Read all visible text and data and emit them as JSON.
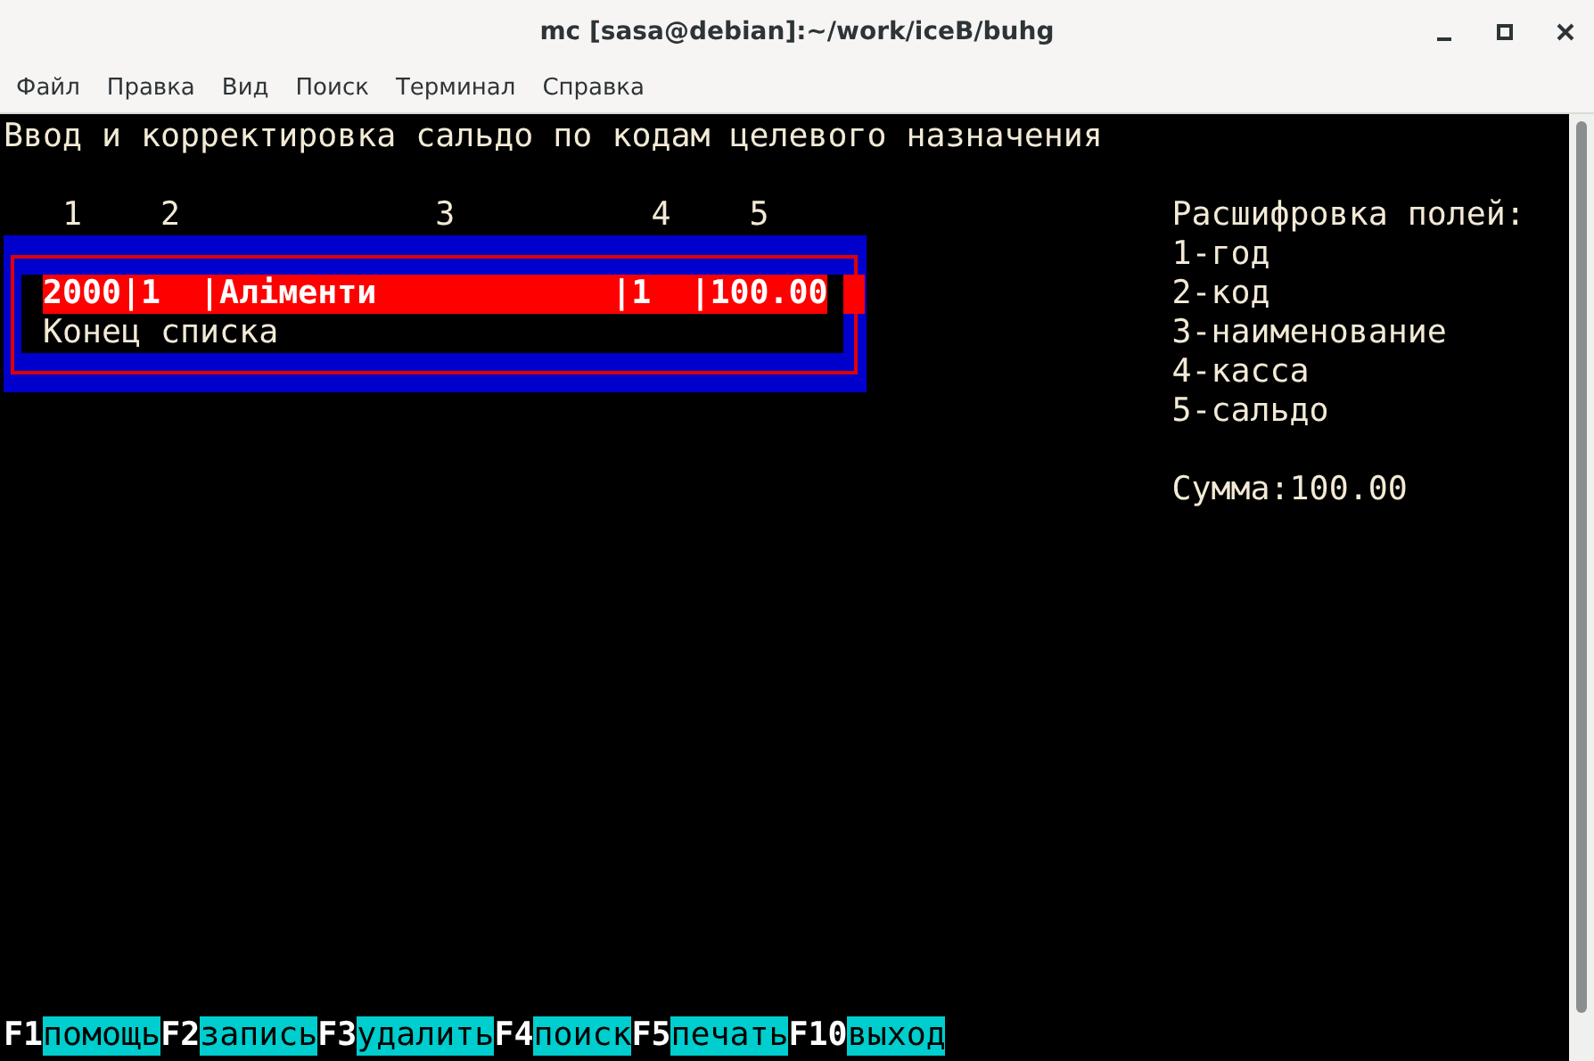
{
  "window": {
    "title": "mc [sasa@debian]:~/work/iceB/buhg"
  },
  "menu": [
    "Файл",
    "Правка",
    "Вид",
    "Поиск",
    "Терминал",
    "Справка"
  ],
  "heading": "Ввод и корректировка сальдо по кодам целевого назначения",
  "column_numbers": [
    "1",
    "2",
    "3",
    "4",
    "5"
  ],
  "rows": [
    {
      "text": "2000|1  |Аліменти            |1  |100.00",
      "selected": true
    },
    {
      "text": "Конец списка",
      "selected": false
    }
  ],
  "legend": {
    "title": "Расшифровка полей:",
    "items": [
      "1-год",
      "2-код",
      "3-наименование",
      "4-касса",
      "5-сальдо"
    ]
  },
  "total": "Сумма:100.00",
  "function_keys": [
    {
      "key": "F1",
      "label": "помощь"
    },
    {
      "key": "F2",
      "label": "запись"
    },
    {
      "key": "F3",
      "label": "удалить"
    },
    {
      "key": "F4",
      "label": "поиск"
    },
    {
      "key": "F5",
      "label": "печать"
    },
    {
      "key": "F10",
      "label": "выход"
    }
  ]
}
